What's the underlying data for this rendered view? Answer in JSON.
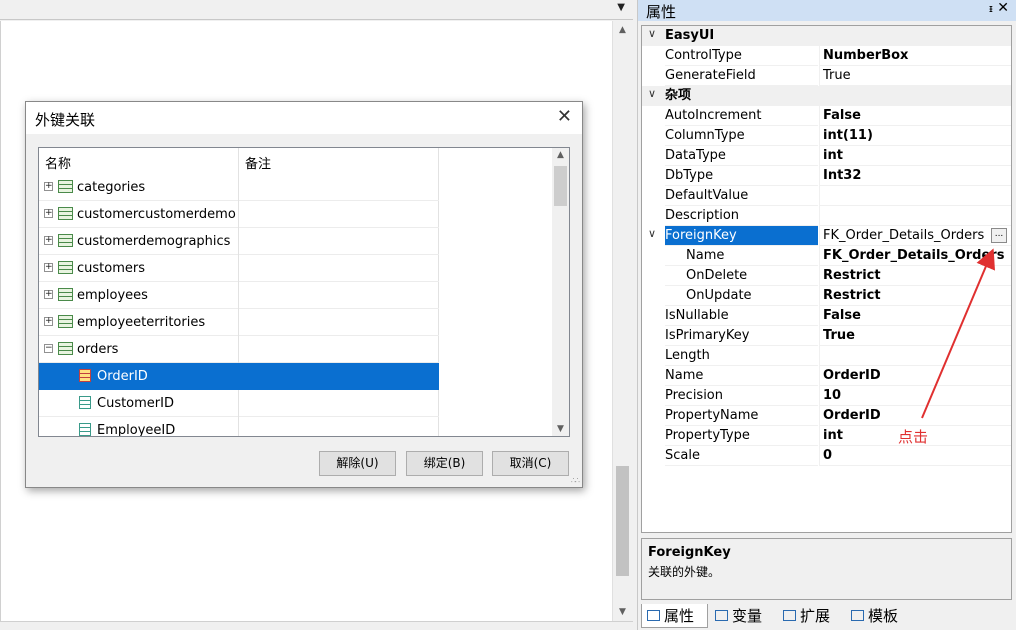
{
  "dialog": {
    "title": "外键关联",
    "close": "✕",
    "headers": [
      "名称",
      "备注"
    ],
    "rows": [
      {
        "label": "categories",
        "kind": "table",
        "expander": "+"
      },
      {
        "label": "customercustomerdemo",
        "kind": "table",
        "expander": "+"
      },
      {
        "label": "customerdemographics",
        "kind": "table",
        "expander": "+"
      },
      {
        "label": "customers",
        "kind": "table",
        "expander": "+"
      },
      {
        "label": "employees",
        "kind": "table",
        "expander": "+"
      },
      {
        "label": "employeeterritories",
        "kind": "table",
        "expander": "+"
      },
      {
        "label": "orders",
        "kind": "table",
        "expander": "−"
      },
      {
        "label": "OrderID",
        "kind": "key",
        "selected": true
      },
      {
        "label": "CustomerID",
        "kind": "field"
      },
      {
        "label": "EmployeeID",
        "kind": "field"
      }
    ],
    "buttons": {
      "unbind": "解除(U)",
      "bind": "绑定(B)",
      "cancel": "取消(C)"
    }
  },
  "panel": {
    "title": "属性",
    "pin": "ꟸ",
    "close": "✕",
    "categories": {
      "easyui": "EasyUI",
      "misc": "杂项"
    },
    "props": {
      "controltype": {
        "name": "ControlType",
        "value": "NumberBox"
      },
      "generatefield": {
        "name": "GenerateField",
        "value": "True"
      },
      "autoincrement": {
        "name": "AutoIncrement",
        "value": "False"
      },
      "columntype": {
        "name": "ColumnType",
        "value": "int(11)"
      },
      "datatype": {
        "name": "DataType",
        "value": "int"
      },
      "dbtype": {
        "name": "DbType",
        "value": "Int32"
      },
      "defaultvalue": {
        "name": "DefaultValue",
        "value": ""
      },
      "description": {
        "name": "Description",
        "value": ""
      },
      "foreignkey": {
        "name": "ForeignKey",
        "value": "FK_Order_Details_Orders"
      },
      "fk_name": {
        "name": "Name",
        "value": "FK_Order_Details_Orders"
      },
      "fk_ondelete": {
        "name": "OnDelete",
        "value": "Restrict"
      },
      "fk_onupdate": {
        "name": "OnUpdate",
        "value": "Restrict"
      },
      "isnullable": {
        "name": "IsNullable",
        "value": "False"
      },
      "isprimarykey": {
        "name": "IsPrimaryKey",
        "value": "True"
      },
      "length": {
        "name": "Length",
        "value": ""
      },
      "name": {
        "name": "Name",
        "value": "OrderID"
      },
      "precision": {
        "name": "Precision",
        "value": "10"
      },
      "propertyname": {
        "name": "PropertyName",
        "value": "OrderID"
      },
      "propertytype": {
        "name": "PropertyType",
        "value": "int"
      },
      "scale": {
        "name": "Scale",
        "value": "0"
      }
    },
    "ellipsis": "...",
    "description": {
      "title": "ForeignKey",
      "text": "关联的外键。"
    },
    "tabs": [
      "属性",
      "变量",
      "扩展",
      "模板"
    ]
  },
  "annotation": "点击",
  "colors": {
    "selection": "#0a6fd0",
    "annotation": "#e03030"
  }
}
